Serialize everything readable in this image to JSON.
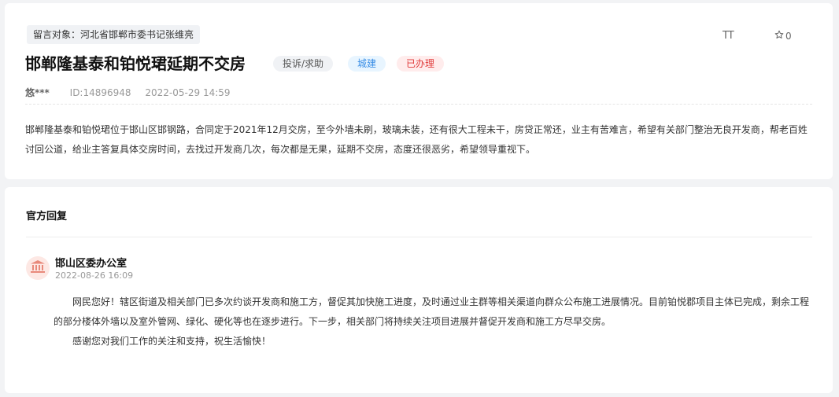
{
  "post": {
    "target_label": "留言对象：河北省邯郸市委书记张维亮",
    "title": "邯郸隆基泰和铂悦珺延期不交房",
    "tags": {
      "category": "投诉/求助",
      "domain": "城建",
      "status": "已办理"
    },
    "font_tool_label": "TT",
    "favorite_count": "0",
    "author": "悠***",
    "id_text": "ID:14896948",
    "datetime": "2022-05-29 14:59",
    "body": "邯郸隆基泰和铂悦珺位于邯山区邯钢路，合同定于2021年12月交房，至今外墙未刷，玻璃未装，还有很大工程未干，房贷正常还，业主有苦难言，希望有关部门整治无良开发商，帮老百姓讨回公道，给业主答复具体交房时间，去找过开发商几次，每次都是无果，延期不交房，态度还很恶劣，希望领导重视下。"
  },
  "reply": {
    "heading": "官方回复",
    "office": "邯山区委办公室",
    "datetime": "2022-08-26 16:09",
    "paragraphs": [
      "网民您好！辖区街道及相关部门已多次约谈开发商和施工方，督促其加快施工进度，及时通过业主群等相关渠道向群众公布施工进展情况。目前铂悦郡项目主体已完成，剩余工程的部分楼体外墙以及室外管网、绿化、硬化等也在逐步进行。下一步，相关部门将持续关注项目进展并督促开发商和施工方尽早交房。",
      "感谢您对我们工作的关注和支持，祝生活愉快！"
    ]
  },
  "colors": {
    "status_red": "#e03a3a",
    "domain_blue": "#3a8ee6",
    "avatar_bg": "#fde8e4"
  },
  "icons": {
    "favorite": "star-outline-icon",
    "office": "government-building-icon",
    "font": "font-size-icon"
  }
}
